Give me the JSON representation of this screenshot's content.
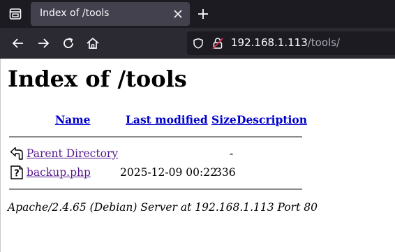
{
  "browser": {
    "tab_title": "Index of /tools",
    "url_host": "192.168.1.113",
    "url_path": "/tools/"
  },
  "page": {
    "heading": "Index of /tools",
    "columns": {
      "name": "Name",
      "last_modified": "Last modified",
      "size": "Size",
      "description": "Description"
    },
    "rows": [
      {
        "icon": "back-icon",
        "name": "Parent Directory",
        "last_modified": "",
        "size": "-",
        "description": ""
      },
      {
        "icon": "unknown-file-icon",
        "name": "backup.php",
        "last_modified": "2025-12-09 00:22",
        "size": "336",
        "description": ""
      }
    ],
    "address": "Apache/2.4.65 (Debian) Server at 192.168.1.113 Port 80"
  }
}
